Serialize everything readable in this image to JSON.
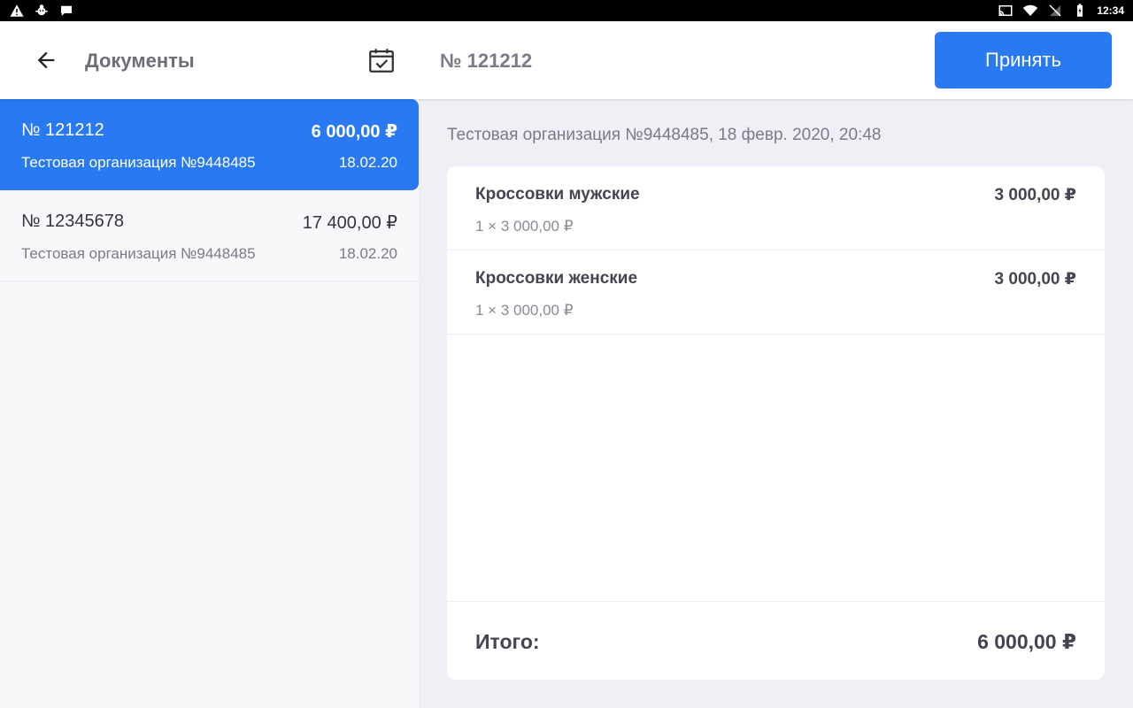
{
  "status_bar": {
    "time": "12:34",
    "icons": [
      "warning-icon",
      "bug-icon",
      "chat-icon",
      "cast-icon",
      "wifi-icon",
      "signal-off-icon",
      "battery-charging-icon"
    ]
  },
  "header": {
    "left_title": "Документы",
    "document_title": "№ 121212",
    "accept_label": "Принять"
  },
  "documents": [
    {
      "number": "№ 121212",
      "amount": "6 000,00 ₽",
      "organization": "Тестовая организация №9448485",
      "date": "18.02.20",
      "selected": true
    },
    {
      "number": "№ 12345678",
      "amount": "17 400,00 ₽",
      "organization": "Тестовая организация №9448485",
      "date": "18.02.20",
      "selected": false
    }
  ],
  "detail": {
    "subtitle": "Тестовая организация №9448485, 18 февр. 2020, 20:48",
    "items": [
      {
        "name": "Кроссовки мужские",
        "total": "3 000,00 ₽",
        "quantity_price": "1 × 3 000,00 ₽"
      },
      {
        "name": "Кроссовки женские",
        "total": "3 000,00 ₽",
        "quantity_price": "1 × 3 000,00 ₽"
      }
    ],
    "total_label": "Итого:",
    "total_value": "6 000,00 ₽"
  },
  "colors": {
    "accent": "#2979f2",
    "background_right": "#efeff6",
    "background_left": "#f8f8fb"
  }
}
